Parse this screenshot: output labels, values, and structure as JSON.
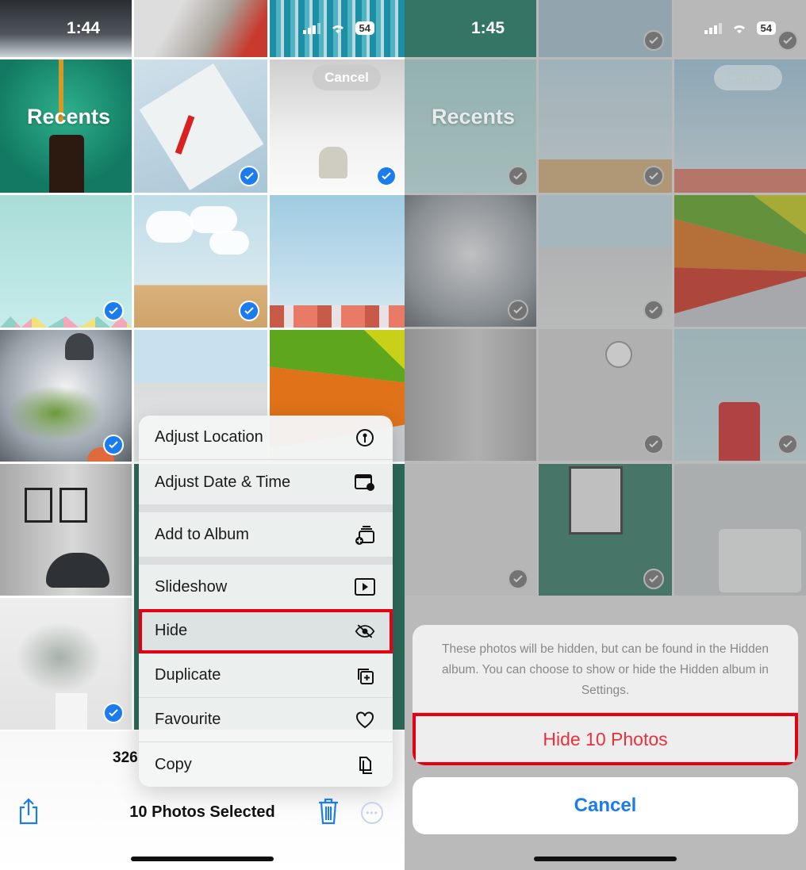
{
  "left": {
    "status": {
      "time": "1:44",
      "battery": "54"
    },
    "header": {
      "title": "Recents",
      "cancel_label": "Cancel"
    },
    "context_menu": {
      "items": [
        {
          "label": "Adjust Location",
          "icon": "location-pin-icon"
        },
        {
          "label": "Adjust Date & Time",
          "icon": "calendar-clock-icon"
        },
        {
          "label": "Add to Album",
          "icon": "add-album-icon"
        },
        {
          "label": "Slideshow",
          "icon": "play-icon"
        },
        {
          "label": "Hide",
          "icon": "eye-slash-icon",
          "highlighted": true
        },
        {
          "label": "Duplicate",
          "icon": "duplicate-icon"
        },
        {
          "label": "Favourite",
          "icon": "heart-icon"
        },
        {
          "label": "Copy",
          "icon": "copy-icon"
        }
      ]
    },
    "toolbar": {
      "count_partial": "326",
      "selected_label": "10 Photos Selected",
      "share_icon": "share-icon",
      "trash_icon": "trash-icon",
      "more_icon": "ellipsis-circle-icon"
    }
  },
  "right": {
    "status": {
      "time": "1:45",
      "battery": "54"
    },
    "header": {
      "title": "Recents",
      "cancel_label": "Cancel"
    },
    "action_sheet": {
      "message": "These photos will be hidden, but can be found in the Hidden album. You can choose to show or hide the Hidden album in Settings.",
      "action_label": "Hide 10 Photos",
      "cancel_label": "Cancel"
    }
  },
  "colors": {
    "accent_blue": "#1a7cf0",
    "destructive_red": "#e7323b",
    "highlight_outline": "#e30012"
  }
}
